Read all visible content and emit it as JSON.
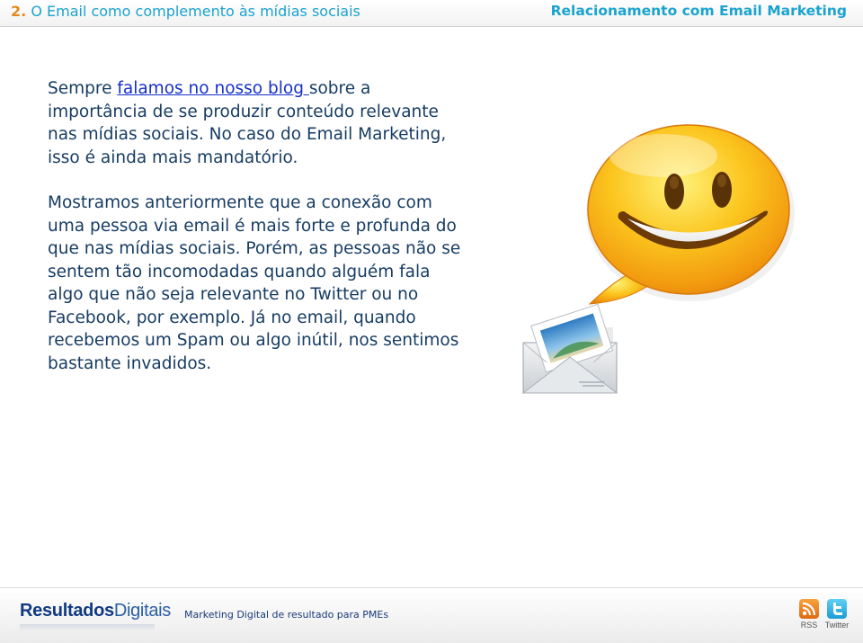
{
  "header": {
    "section_number": "2.",
    "section_title": "O Email como complemento às mídias sociais",
    "chapter_title": "Relacionamento com Email Marketing"
  },
  "body": {
    "p1_before": "Sempre ",
    "p1_link": "falamos no nosso blog ",
    "p1_after": "sobre a importância de se produzir conteúdo relevante nas mídias sociais. No caso do Email Marketing, isso é ainda mais mandatório.",
    "p2": "Mostramos anteriormente que a conexão com uma pessoa via email é mais forte e profunda do que nas mídias sociais. Porém, as pessoas não se sentem tão incomodadas quando alguém fala algo que não seja relevante no Twitter ou no Facebook, por exemplo. Já no email, quando recebemos um Spam ou algo inútil, nos sentimos bastante invadidos."
  },
  "footer": {
    "logo_bold": "Resultados",
    "logo_light": "Digitais",
    "tagline": "Marketing Digital de resultado para PMEs",
    "rss_label": "RSS",
    "twitter_label": "Twitter"
  },
  "colors": {
    "accent_blue": "#1aa3cf",
    "section_number_orange": "#e18a1e",
    "body_text": "#173c63",
    "link": "#1530c8"
  },
  "icons": [
    "smiley-speech-bubble-icon",
    "envelope-photo-icon",
    "rss-icon",
    "twitter-icon"
  ]
}
